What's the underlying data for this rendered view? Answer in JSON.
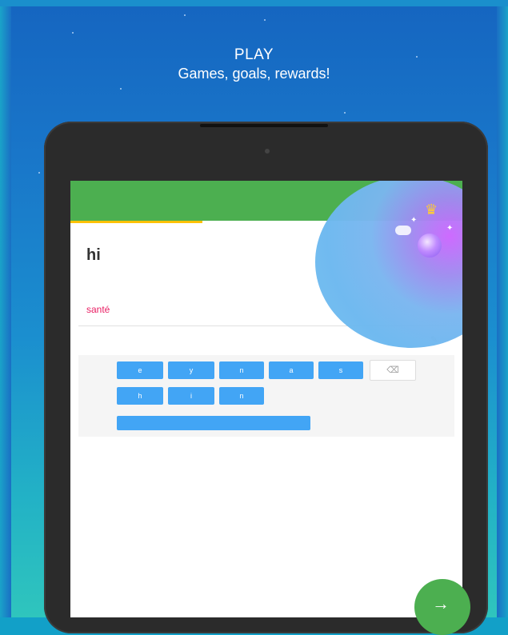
{
  "promo": {
    "title": "PLAY",
    "subtitle": "Games, goals, rewards!"
  },
  "lesson": {
    "prompt_label": "",
    "word": "hi",
    "answer": "santé",
    "hint": ""
  },
  "keyboard": {
    "row1": [
      "e",
      "y",
      "n",
      "a",
      "s"
    ],
    "row2": [
      "h",
      "i",
      "n"
    ],
    "delete_symbol": "⌫"
  },
  "icons": {
    "trophy": "trophy-icon",
    "avatar": "avatar-icon",
    "pencil": "pencil-icon",
    "next": "arrow-right-icon"
  },
  "colors": {
    "appbar": "#4caf50",
    "key": "#42a5f5",
    "answer": "#e91e63",
    "fab": "#4caf50"
  }
}
